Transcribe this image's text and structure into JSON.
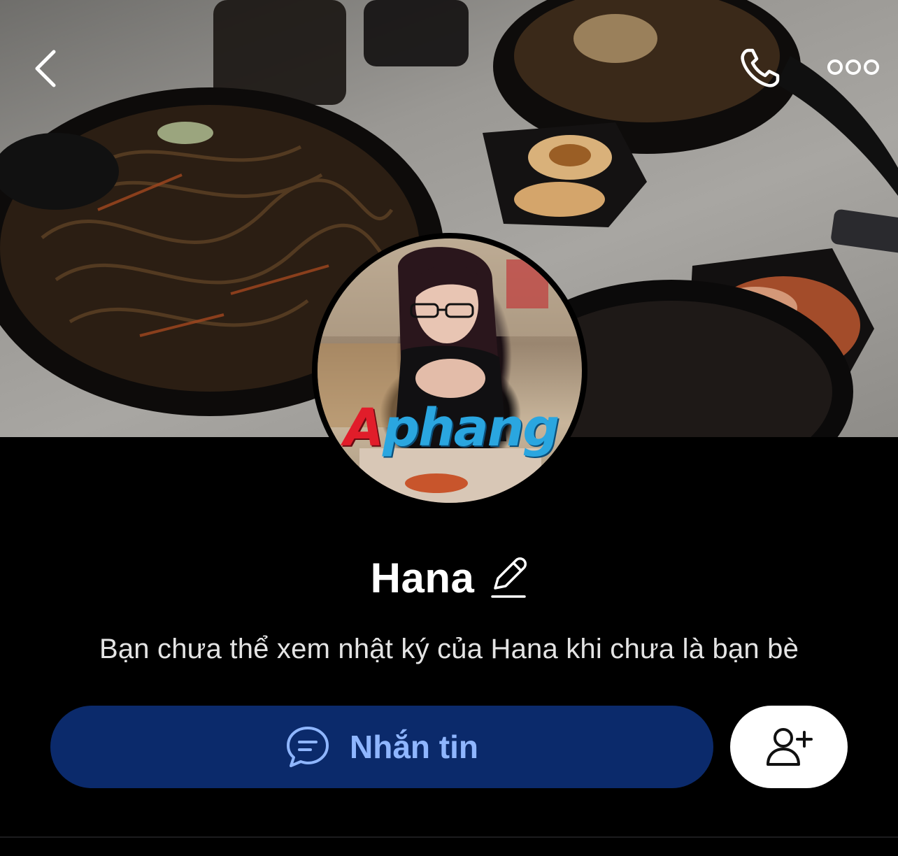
{
  "header": {
    "back_icon": "chevron-left-icon",
    "call_icon": "phone-icon",
    "more_icon": "more-dots-icon"
  },
  "profile": {
    "name": "Hana",
    "edit_icon": "pencil-icon",
    "watermark_first": "A",
    "watermark_rest": "phang",
    "privacy_notice": "Bạn chưa thể xem nhật ký của Hana khi chưa là bạn bè"
  },
  "actions": {
    "message_label": "Nhắn tin",
    "message_icon": "chat-bubble-icon",
    "add_friend_icon": "add-friend-icon"
  },
  "colors": {
    "background": "#000000",
    "message_button_bg": "#0b2a6b",
    "message_button_text": "#8fb6ff",
    "add_button_bg": "#ffffff"
  }
}
